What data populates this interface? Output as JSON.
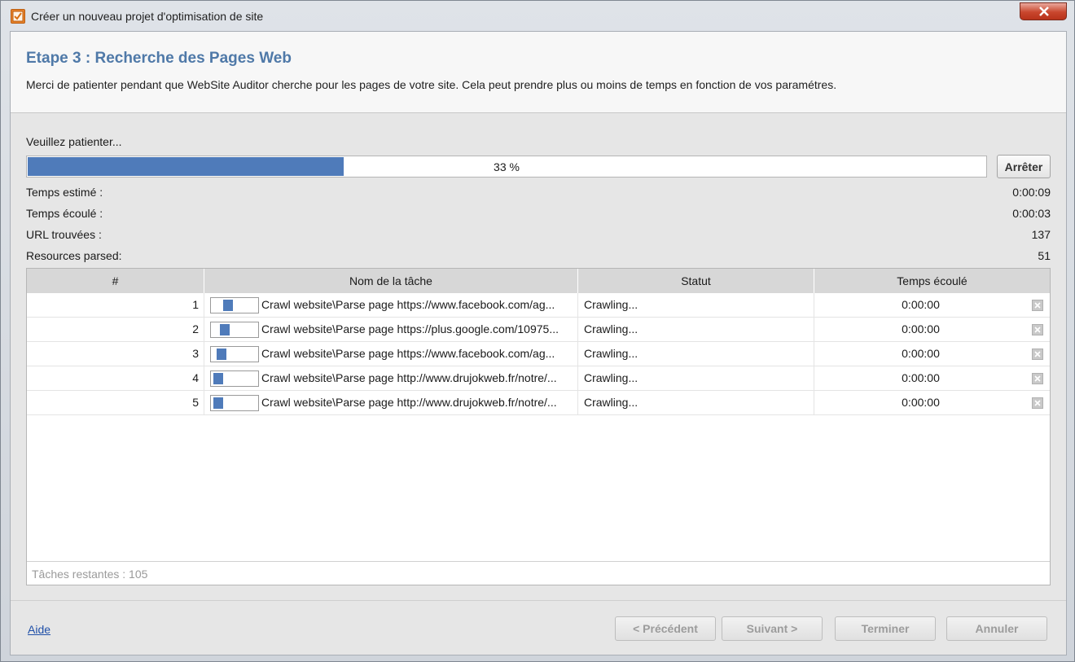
{
  "window": {
    "title": "Créer un nouveau projet d'optimisation de site"
  },
  "header": {
    "step_title": "Etape 3 : Recherche des Pages Web",
    "description": "Merci de patienter pendant que WebSite Auditor cherche pour les pages de votre site. Cela peut prendre plus ou moins de temps en fonction de vos paramétres."
  },
  "progress": {
    "label": "Veuillez patienter...",
    "percent": 33,
    "percent_text": "33 %",
    "stop_label": "Arrêter"
  },
  "stats": [
    {
      "label": "Temps estimé :",
      "value": "0:00:09"
    },
    {
      "label": "Temps écoulé :",
      "value": "0:00:03"
    },
    {
      "label": "URL trouvées :",
      "value": "137"
    },
    {
      "label": "Resources parsed:",
      "value": "51"
    }
  ],
  "table": {
    "headers": [
      "#",
      "Nom de la tâche",
      "Statut",
      "Temps écoulé"
    ],
    "rows": [
      {
        "num": "1",
        "task": "Crawl website\\Parse page https://www.facebook.com/ag...",
        "status": "Crawling...",
        "time": "0:00:00",
        "indicator_pos": 0.3
      },
      {
        "num": "2",
        "task": "Crawl website\\Parse page https://plus.google.com/10975...",
        "status": "Crawling...",
        "time": "0:00:00",
        "indicator_pos": 0.22
      },
      {
        "num": "3",
        "task": "Crawl website\\Parse page https://www.facebook.com/ag...",
        "status": "Crawling...",
        "time": "0:00:00",
        "indicator_pos": 0.12
      },
      {
        "num": "4",
        "task": "Crawl website\\Parse page http://www.drujokweb.fr/notre/...",
        "status": "Crawling...",
        "time": "0:00:00",
        "indicator_pos": 0.02
      },
      {
        "num": "5",
        "task": "Crawl website\\Parse page http://www.drujokweb.fr/notre/...",
        "status": "Crawling...",
        "time": "0:00:00",
        "indicator_pos": 0.02
      }
    ],
    "remaining": "Tâches restantes : 105"
  },
  "footer": {
    "help": "Aide",
    "previous": "< Précédent",
    "next": "Suivant >",
    "finish": "Terminer",
    "cancel": "Annuler"
  },
  "colors": {
    "accent": "#4f79a8",
    "progress": "#4f7bba",
    "link": "#1f4fa8"
  }
}
